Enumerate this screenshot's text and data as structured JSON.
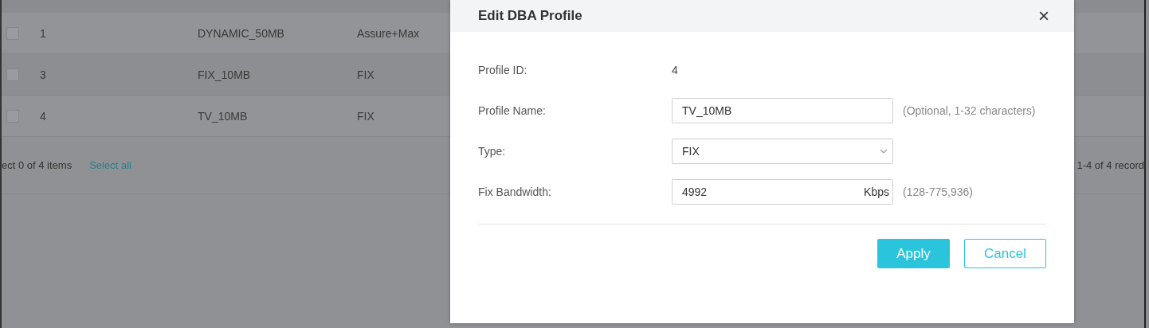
{
  "table": {
    "rows": [
      {
        "checked": false,
        "id": "1",
        "name": "DYNAMIC_50MB",
        "type": "Assure+Max"
      },
      {
        "checked": false,
        "id": "3",
        "name": "FIX_10MB",
        "type": "FIX"
      },
      {
        "checked": false,
        "id": "4",
        "name": "TV_10MB",
        "type": "FIX"
      }
    ],
    "selection_text": "ect 0 of 4 items",
    "select_all": "Select all",
    "records": "1-4 of 4 record"
  },
  "dialog": {
    "title": "Edit DBA Profile",
    "close": "×",
    "fields": [
      {
        "kind": "static",
        "label": "Profile ID:",
        "value": "4"
      },
      {
        "kind": "text",
        "label": "Profile Name:",
        "value": "TV_10MB",
        "hint": "(Optional, 1-32 characters)"
      },
      {
        "kind": "select",
        "label": "Type:",
        "value": "FIX"
      },
      {
        "kind": "unit",
        "label": "Fix Bandwidth:",
        "value": "4992",
        "unit": "Kbps",
        "hint": "(128-775,936)"
      }
    ],
    "buttons": [
      {
        "kind": "primary",
        "label": "Apply"
      },
      {
        "kind": "secondary",
        "label": "Cancel"
      }
    ]
  }
}
